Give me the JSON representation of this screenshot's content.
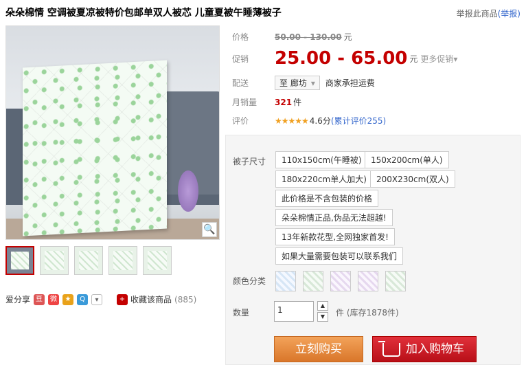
{
  "title": "朵朵棉情 空调被夏凉被特价包邮单双人被芯 儿童夏被午睡薄被子",
  "report": {
    "text": "举报此商品",
    "link": "(举报)"
  },
  "price": {
    "label": "价格",
    "value": "50.00 - 130.00",
    "unit": "元"
  },
  "promo": {
    "label": "促销",
    "value": "25.00 - 65.00",
    "unit": "元",
    "more": "更多促销"
  },
  "delivery": {
    "label": "配送",
    "location": "至 廊坊",
    "note": "商家承担运费"
  },
  "monthly_sales": {
    "label": "月销量",
    "value": "321",
    "unit": "件"
  },
  "rating": {
    "label": "评价",
    "stars": "★★★★★",
    "score": "4.6分",
    "count": "(累计评价255)"
  },
  "sku": {
    "size_label": "被子尺寸",
    "options": [
      "110x150cm(午睡被)",
      "150x200cm(单人)",
      "180x220cm单人加大)",
      "200X230cm(双人)",
      "此价格是不含包装的价格",
      "朵朵棉情正品,伪品无法超越!",
      "13年新款花型,全网独家首发!",
      "如果大量需要包装可以联系我们"
    ],
    "color_label": "颜色分类",
    "qty_label": "数量",
    "qty_value": "1",
    "stock": "件 (库存1878件)"
  },
  "buttons": {
    "buy": "立刻购买",
    "cart": "加入购物车"
  },
  "share": {
    "label": "爱分享"
  },
  "favorite": {
    "label": "收藏该商品",
    "count": "(885)"
  },
  "colors": {
    "price_red": "#c40000",
    "buy_orange": "#e88a3c",
    "cart_red": "#c8161d"
  }
}
